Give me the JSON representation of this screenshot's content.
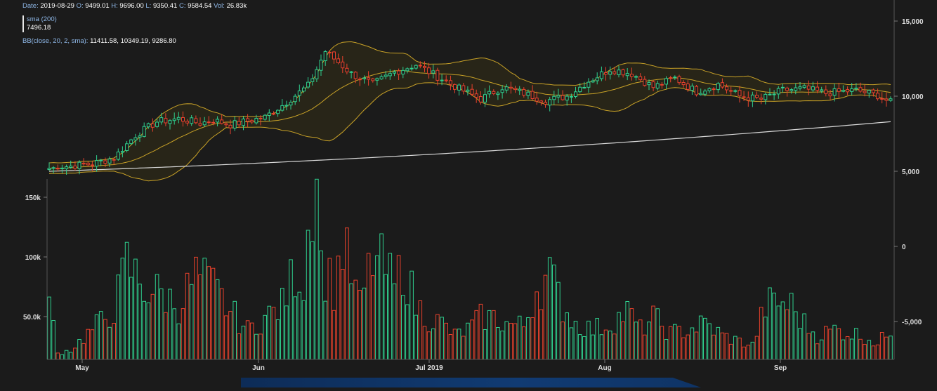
{
  "header": {
    "date_label": "Date:",
    "date": "2019-08-29",
    "o_label": "O:",
    "o": "9499.01",
    "h_label": "H:",
    "h": "9696.00",
    "l_label": "L:",
    "l": "9350.41",
    "c_label": "C:",
    "c": "9584.54",
    "vol_label": "Vol:",
    "vol": "26.83k",
    "sma_label": "sma (200)",
    "sma_value": "7496.18",
    "bb_label": "BB(close, 20, 2, sma):",
    "bb_values": "11411.58, 10349.19, 9286.80"
  },
  "colors": {
    "background": "#1b1b1b",
    "up": "#2fcf8e",
    "down": "#e8412c",
    "bollinger": "#c9a227",
    "bollinger_fill": "#2a2718",
    "sma": "#d8d8d8",
    "axis_text": "#dddddd"
  },
  "chart_data": {
    "type": "candlestick",
    "x_ticks": [
      "May",
      "Jun",
      "Jul 2019",
      "Aug",
      "Sep"
    ],
    "price_axis": {
      "position": "right",
      "ticks": [
        "15,000",
        "10,000",
        "5,000",
        "0",
        "-5,000"
      ]
    },
    "volume_axis": {
      "position": "left",
      "ticks": [
        "150k",
        "100k",
        "50.0k"
      ]
    },
    "series": [
      {
        "name": "sma (200)",
        "type": "line",
        "start": 5000,
        "end": 8300
      },
      {
        "name": "BB(close, 20, 2, sma)",
        "type": "band"
      }
    ],
    "price_anchors": [
      [
        0,
        5200
      ],
      [
        10,
        5500
      ],
      [
        15,
        5900
      ],
      [
        20,
        7400
      ],
      [
        25,
        8300
      ],
      [
        30,
        8500
      ],
      [
        35,
        8200
      ],
      [
        38,
        8400
      ],
      [
        42,
        8100
      ],
      [
        50,
        8600
      ],
      [
        55,
        9600
      ],
      [
        60,
        10700
      ],
      [
        62,
        11800
      ],
      [
        64,
        13000
      ],
      [
        66,
        12500
      ],
      [
        70,
        11500
      ],
      [
        75,
        10800
      ],
      [
        80,
        11600
      ],
      [
        85,
        12100
      ],
      [
        90,
        11300
      ],
      [
        95,
        10500
      ],
      [
        100,
        9800
      ],
      [
        105,
        10600
      ],
      [
        110,
        10200
      ],
      [
        115,
        9700
      ],
      [
        120,
        10000
      ],
      [
        125,
        11000
      ],
      [
        130,
        11800
      ],
      [
        135,
        11500
      ],
      [
        140,
        10600
      ],
      [
        145,
        11200
      ],
      [
        150,
        10300
      ],
      [
        155,
        10800
      ],
      [
        160,
        10000
      ],
      [
        165,
        9800
      ],
      [
        170,
        10400
      ],
      [
        175,
        10500
      ],
      [
        180,
        10200
      ],
      [
        187,
        10400
      ],
      [
        192,
        10050
      ],
      [
        195,
        9580
      ]
    ],
    "volume_anchors": [
      [
        0,
        48
      ],
      [
        2,
        5
      ],
      [
        5,
        8
      ],
      [
        10,
        25
      ],
      [
        15,
        42
      ],
      [
        18,
        80
      ],
      [
        22,
        60
      ],
      [
        26,
        55
      ],
      [
        30,
        45
      ],
      [
        34,
        70
      ],
      [
        38,
        60
      ],
      [
        42,
        40
      ],
      [
        46,
        25
      ],
      [
        50,
        35
      ],
      [
        54,
        45
      ],
      [
        57,
        75
      ],
      [
        59,
        65
      ],
      [
        61,
        150
      ],
      [
        62,
        170
      ],
      [
        63,
        80
      ],
      [
        66,
        60
      ],
      [
        68,
        95
      ],
      [
        70,
        70
      ],
      [
        72,
        45
      ],
      [
        75,
        85
      ],
      [
        78,
        75
      ],
      [
        80,
        60
      ],
      [
        82,
        80
      ],
      [
        85,
        45
      ],
      [
        88,
        35
      ],
      [
        91,
        30
      ],
      [
        94,
        20
      ],
      [
        97,
        25
      ],
      [
        100,
        35
      ],
      [
        103,
        35
      ],
      [
        106,
        30
      ],
      [
        110,
        28
      ],
      [
        113,
        60
      ],
      [
        116,
        70
      ],
      [
        119,
        45
      ],
      [
        122,
        30
      ],
      [
        126,
        25
      ],
      [
        130,
        30
      ],
      [
        134,
        40
      ],
      [
        137,
        25
      ],
      [
        140,
        35
      ],
      [
        144,
        22
      ],
      [
        148,
        25
      ],
      [
        152,
        30
      ],
      [
        156,
        20
      ],
      [
        160,
        15
      ],
      [
        163,
        12
      ],
      [
        166,
        45
      ],
      [
        169,
        48
      ],
      [
        172,
        45
      ],
      [
        175,
        30
      ],
      [
        178,
        20
      ],
      [
        182,
        25
      ],
      [
        186,
        22
      ],
      [
        190,
        18
      ],
      [
        192,
        12
      ],
      [
        195,
        27
      ]
    ]
  }
}
